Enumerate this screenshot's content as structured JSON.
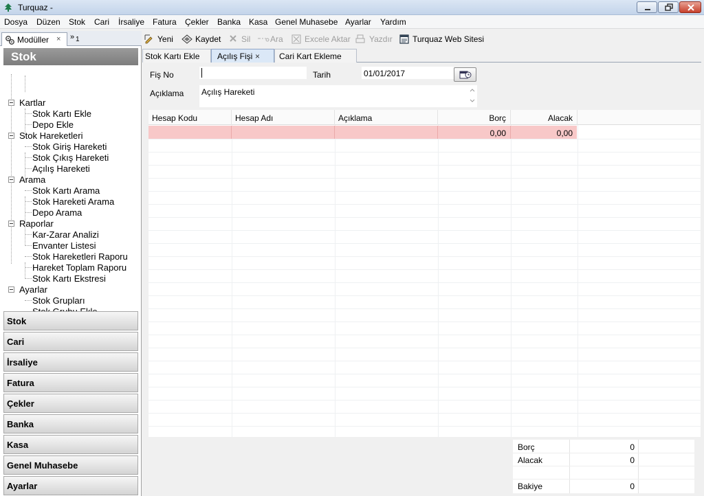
{
  "window": {
    "title": "Turquaz -"
  },
  "menu": [
    "Dosya",
    "Düzen",
    "Stok",
    "Cari",
    "İrsaliye",
    "Fatura",
    "Çekler",
    "Banka",
    "Kasa",
    "Genel Muhasebe",
    "Ayarlar",
    "Yardım"
  ],
  "left_panel": {
    "tab_label": "Modüller",
    "tab_close": "×",
    "overflow_symbol": "»",
    "overflow_count": "1",
    "section_title": "Stok",
    "tree": [
      {
        "label": "Kartlar",
        "children": [
          "Stok Kartı Ekle",
          "Depo Ekle"
        ]
      },
      {
        "label": "Stok Hareketleri",
        "children": [
          "Stok Giriş Hareketi",
          "Stok Çıkış Hareketi",
          "Açılış Hareketi"
        ]
      },
      {
        "label": "Arama",
        "children": [
          "Stok Kartı Arama",
          "Stok Hareketi Arama",
          "Depo Arama"
        ]
      },
      {
        "label": "Raporlar",
        "children": [
          "Kar-Zarar Analizi",
          "Envanter Listesi",
          "Stok Hareketleri Raporu",
          "Hareket Toplam Raporu",
          "Stok Kartı Ekstresi"
        ]
      },
      {
        "label": "Ayarlar",
        "children": [
          "Stok Grupları",
          "Stok Grubu Ekle"
        ]
      }
    ],
    "modules": [
      "Stok",
      "Cari",
      "İrsaliye",
      "Fatura",
      "Çekler",
      "Banka",
      "Kasa",
      "Genel Muhasebe",
      "Ayarlar"
    ]
  },
  "toolbar": {
    "new_label": "Yeni",
    "save_label": "Kaydet",
    "delete_label": "Sil",
    "search_label": "Ara",
    "excel_label": "Excele Aktar",
    "print_label": "Yazdır",
    "website_label": "Turquaz Web Sitesi"
  },
  "doc_tabs": [
    "Stok Kartı Ekle",
    "Açılış Fişi",
    "Cari Kart Ekleme"
  ],
  "active_tab_close": "×",
  "form": {
    "fis_no_label": "Fiş No",
    "fis_no_value": "",
    "tarih_label": "Tarih",
    "tarih_value": "01/01/2017",
    "aciklama_label": "Açıklama",
    "aciklama_value": "Açılış Hareketi"
  },
  "grid": {
    "columns": [
      "Hesap Kodu",
      "Hesap Adı",
      "Açıklama",
      "Borç",
      "Alacak"
    ],
    "rows": [
      [
        "",
        "",
        "",
        "0,00",
        "0,00"
      ]
    ]
  },
  "totals": {
    "borc_label": "Borç",
    "borc_value": "0",
    "alacak_label": "Alacak",
    "alacak_value": "0",
    "bakiye_label": "Bakiye",
    "bakiye_value": "0"
  },
  "colors": {
    "selected_row": "#f8c8c8",
    "section_header": "#8a8a8a"
  }
}
